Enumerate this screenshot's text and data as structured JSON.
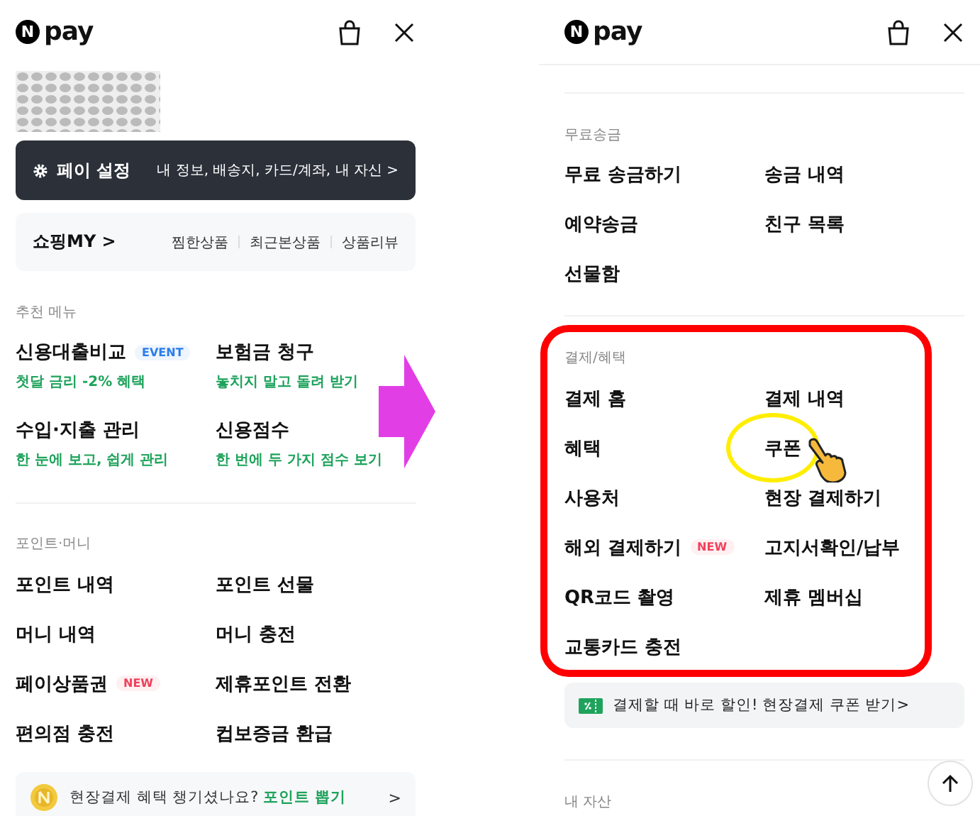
{
  "left": {
    "logo": {
      "mark": "N",
      "text": "pay"
    },
    "settings": {
      "title": "페이 설정",
      "links": "내 정보, 배송지, 카드/계좌, 내 자신 >"
    },
    "shopping": {
      "title": "쇼핑MY >",
      "links": [
        "찜한상품",
        "최근본상품",
        "상품리뷰"
      ]
    },
    "recommended": {
      "heading": "추천 메뉴",
      "items": [
        {
          "title": "신용대출비교",
          "badge": {
            "label": "EVENT",
            "kind": "event"
          },
          "subtitle": "첫달 금리 -2% 혜택"
        },
        {
          "title": "보험금 청구",
          "subtitle": "놓치지 말고 돌려 받기"
        },
        {
          "title": "수입·지출 관리",
          "subtitle": "한 눈에 보고, 쉽게 관리"
        },
        {
          "title": "신용점수",
          "subtitle": "한 번에 두 가지 점수 보기"
        }
      ]
    },
    "points": {
      "heading": "포인트·머니",
      "items": [
        {
          "label": "포인트 내역"
        },
        {
          "label": "포인트 선물"
        },
        {
          "label": "머니 내역"
        },
        {
          "label": "머니 충전"
        },
        {
          "label": "페이상품권",
          "badge": {
            "label": "NEW",
            "kind": "new"
          }
        },
        {
          "label": "제휴포인트 전환"
        },
        {
          "label": "편의점 충전"
        },
        {
          "label": "컵보증금 환급"
        }
      ]
    },
    "banner": {
      "text": "현장결제 혜택 챙기셨나요? **포인트 뽑기**",
      "chevron": ">"
    }
  },
  "right": {
    "logo": {
      "mark": "N",
      "text": "pay"
    },
    "transfer": {
      "heading": "무료송금",
      "items": [
        {
          "label": "무료 송금하기"
        },
        {
          "label": "송금 내역"
        },
        {
          "label": "예약송금"
        },
        {
          "label": "친구 목록"
        },
        {
          "label": "선물함"
        }
      ]
    },
    "payment": {
      "heading": "결제/혜택",
      "items": [
        {
          "label": "결제 홈",
          "highlighted": false
        },
        {
          "label": "결제 내역",
          "highlighted": false
        },
        {
          "label": "혜택",
          "highlighted": false
        },
        {
          "label": "쿠폰",
          "highlighted": true
        },
        {
          "label": "사용처",
          "highlighted": false
        },
        {
          "label": "현장 결제하기",
          "highlighted": false
        },
        {
          "label": "해외 결제하기",
          "badge": {
            "label": "NEW",
            "kind": "new"
          },
          "highlighted": false
        },
        {
          "label": "고지서확인/납부",
          "highlighted": false
        },
        {
          "label": "QR코드 촬영",
          "highlighted": false
        },
        {
          "label": "제휴 멤버십",
          "highlighted": false
        },
        {
          "label": "교통카드 충전",
          "highlighted": false
        }
      ]
    },
    "coupon_banner": {
      "text": "결제할 때 바로 할인! 현장결제 쿠폰 받기>"
    },
    "assets": {
      "heading": "내 자산"
    }
  }
}
